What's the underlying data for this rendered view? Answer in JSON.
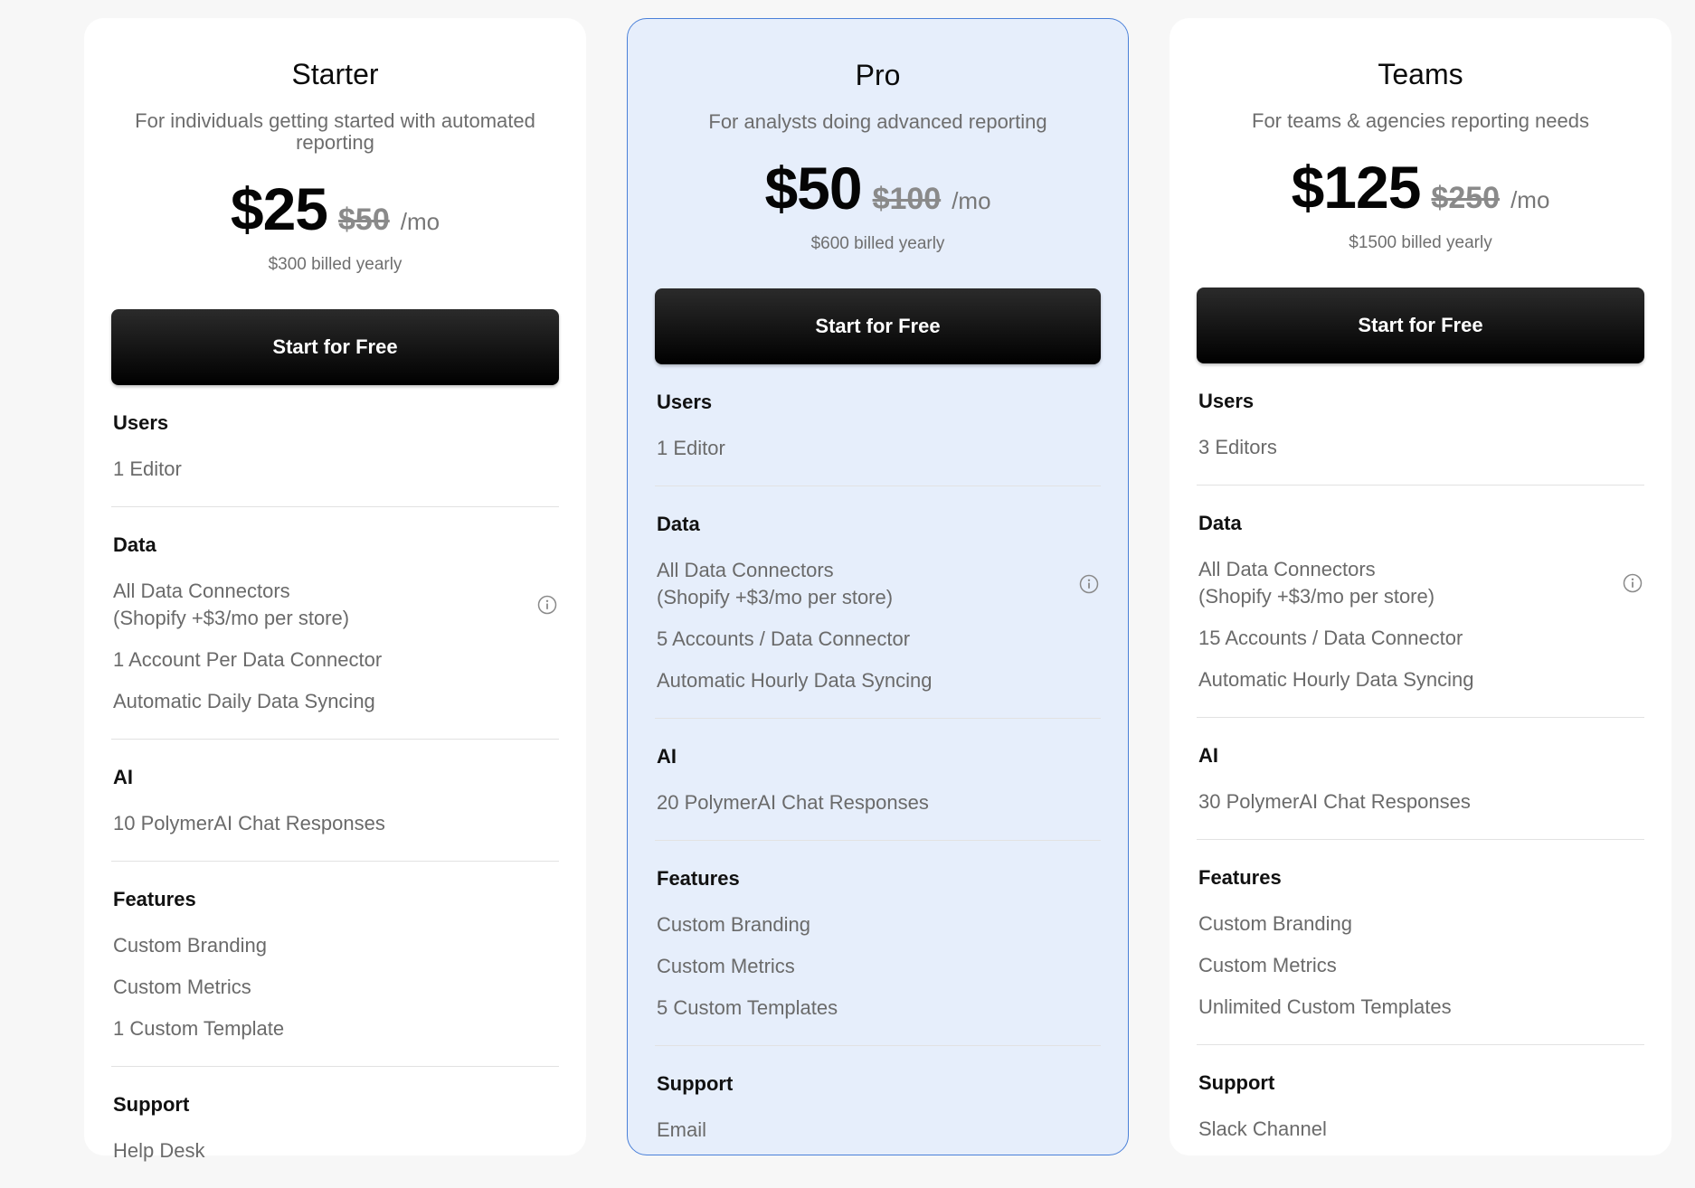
{
  "plans": [
    {
      "name": "Starter",
      "description": "For individuals getting started with automated reporting",
      "price": "$25",
      "old_price": "$50",
      "per": "/mo",
      "billed": "$300 billed yearly",
      "cta": "Start for Free",
      "sections": [
        {
          "title": "Users",
          "items": [
            {
              "lines": [
                "1 Editor"
              ]
            }
          ]
        },
        {
          "title": "Data",
          "items": [
            {
              "lines": [
                "All Data Connectors",
                "(Shopify +$3/mo per store)"
              ],
              "icon": "info-icon"
            },
            {
              "lines": [
                "1 Account Per Data Connector"
              ]
            },
            {
              "lines": [
                "Automatic Daily Data Syncing"
              ]
            }
          ]
        },
        {
          "title": "AI",
          "items": [
            {
              "lines": [
                "10 PolymerAI Chat Responses"
              ]
            }
          ]
        },
        {
          "title": "Features",
          "items": [
            {
              "lines": [
                "Custom Branding"
              ]
            },
            {
              "lines": [
                "Custom Metrics"
              ]
            },
            {
              "lines": [
                "1 Custom Template"
              ]
            }
          ]
        },
        {
          "title": "Support",
          "items": [
            {
              "lines": [
                "Help Desk"
              ]
            }
          ]
        }
      ]
    },
    {
      "name": "Pro",
      "description": "For analysts doing advanced reporting",
      "price": "$50",
      "old_price": "$100",
      "per": "/mo",
      "billed": "$600 billed yearly",
      "cta": "Start for Free",
      "sections": [
        {
          "title": "Users",
          "items": [
            {
              "lines": [
                "1 Editor"
              ]
            }
          ]
        },
        {
          "title": "Data",
          "items": [
            {
              "lines": [
                "All Data Connectors",
                "(Shopify +$3/mo per store)"
              ],
              "icon": "info-icon"
            },
            {
              "lines": [
                "5 Accounts / Data Connector"
              ]
            },
            {
              "lines": [
                "Automatic Hourly Data Syncing"
              ]
            }
          ]
        },
        {
          "title": "AI",
          "items": [
            {
              "lines": [
                "20 PolymerAI Chat Responses"
              ]
            }
          ]
        },
        {
          "title": "Features",
          "items": [
            {
              "lines": [
                "Custom Branding"
              ]
            },
            {
              "lines": [
                "Custom Metrics"
              ]
            },
            {
              "lines": [
                "5 Custom Templates"
              ]
            }
          ]
        },
        {
          "title": "Support",
          "items": [
            {
              "lines": [
                "Email"
              ]
            }
          ]
        }
      ]
    },
    {
      "name": "Teams",
      "description": "For teams & agencies reporting needs",
      "price": "$125",
      "old_price": "$250",
      "per": "/mo",
      "billed": "$1500 billed yearly",
      "cta": "Start for Free",
      "sections": [
        {
          "title": "Users",
          "items": [
            {
              "lines": [
                "3 Editors"
              ]
            }
          ]
        },
        {
          "title": "Data",
          "items": [
            {
              "lines": [
                "All Data Connectors",
                "(Shopify +$3/mo per store)"
              ],
              "icon": "info-icon"
            },
            {
              "lines": [
                "15 Accounts / Data Connector"
              ]
            },
            {
              "lines": [
                "Automatic Hourly Data Syncing"
              ]
            }
          ]
        },
        {
          "title": "AI",
          "items": [
            {
              "lines": [
                "30 PolymerAI Chat Responses"
              ]
            }
          ]
        },
        {
          "title": "Features",
          "items": [
            {
              "lines": [
                "Custom Branding"
              ]
            },
            {
              "lines": [
                "Custom Metrics"
              ]
            },
            {
              "lines": [
                "Unlimited Custom Templates"
              ]
            }
          ]
        },
        {
          "title": "Support",
          "items": [
            {
              "lines": [
                "Slack Channel"
              ]
            }
          ]
        }
      ]
    }
  ],
  "colors": {
    "highlight_bg": "#e6eefb",
    "highlight_border": "#4a80d9",
    "cta_bg": "#000000"
  }
}
